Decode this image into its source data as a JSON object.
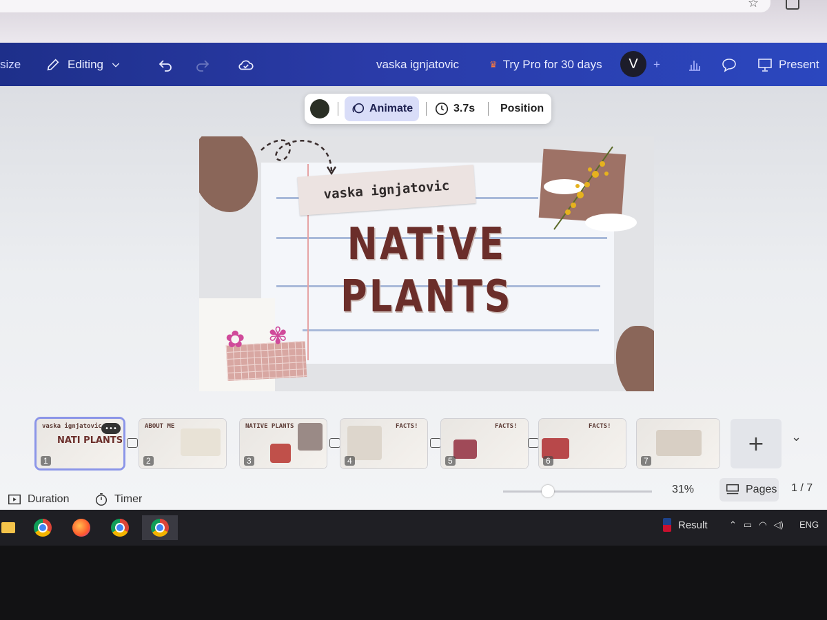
{
  "header": {
    "resize_label": "size",
    "editing_label": "Editing",
    "doc_title": "vaska ignjatovic",
    "pro_label": "Try Pro for 30 days",
    "avatar_letter": "V",
    "present_label": "Present"
  },
  "toolbar": {
    "animate_label": "Animate",
    "duration_label": "3.7s",
    "position_label": "Position",
    "swatch_color": "#2a2f25"
  },
  "slide": {
    "name_tag": "vaska ignjatovic",
    "title_line1": "NATiVE",
    "title_line2": "PLANTS"
  },
  "thumbnails": [
    {
      "num": "1",
      "title": "vaska ignjatovic",
      "big": "NATI PLANTS"
    },
    {
      "num": "2",
      "title": "ABOUT ME",
      "big": ""
    },
    {
      "num": "3",
      "title": "NATIVE PLANTS",
      "big": ""
    },
    {
      "num": "4",
      "title": "FACTS!",
      "big": ""
    },
    {
      "num": "5",
      "title": "FACTS!",
      "big": ""
    },
    {
      "num": "6",
      "title": "FACTS!",
      "big": ""
    },
    {
      "num": "7",
      "title": "",
      "big": ""
    }
  ],
  "bottombar": {
    "duration_label": "Duration",
    "timer_label": "Timer",
    "zoom": "31%",
    "pages_label": "Pages",
    "page_count": "1 / 7"
  },
  "taskbar": {
    "result_label": "Result",
    "lang": "ENG"
  },
  "colors": {
    "header_blue": "#2a3ba8",
    "title_brown": "#6b2e2a",
    "selection": "#8b95e8"
  }
}
